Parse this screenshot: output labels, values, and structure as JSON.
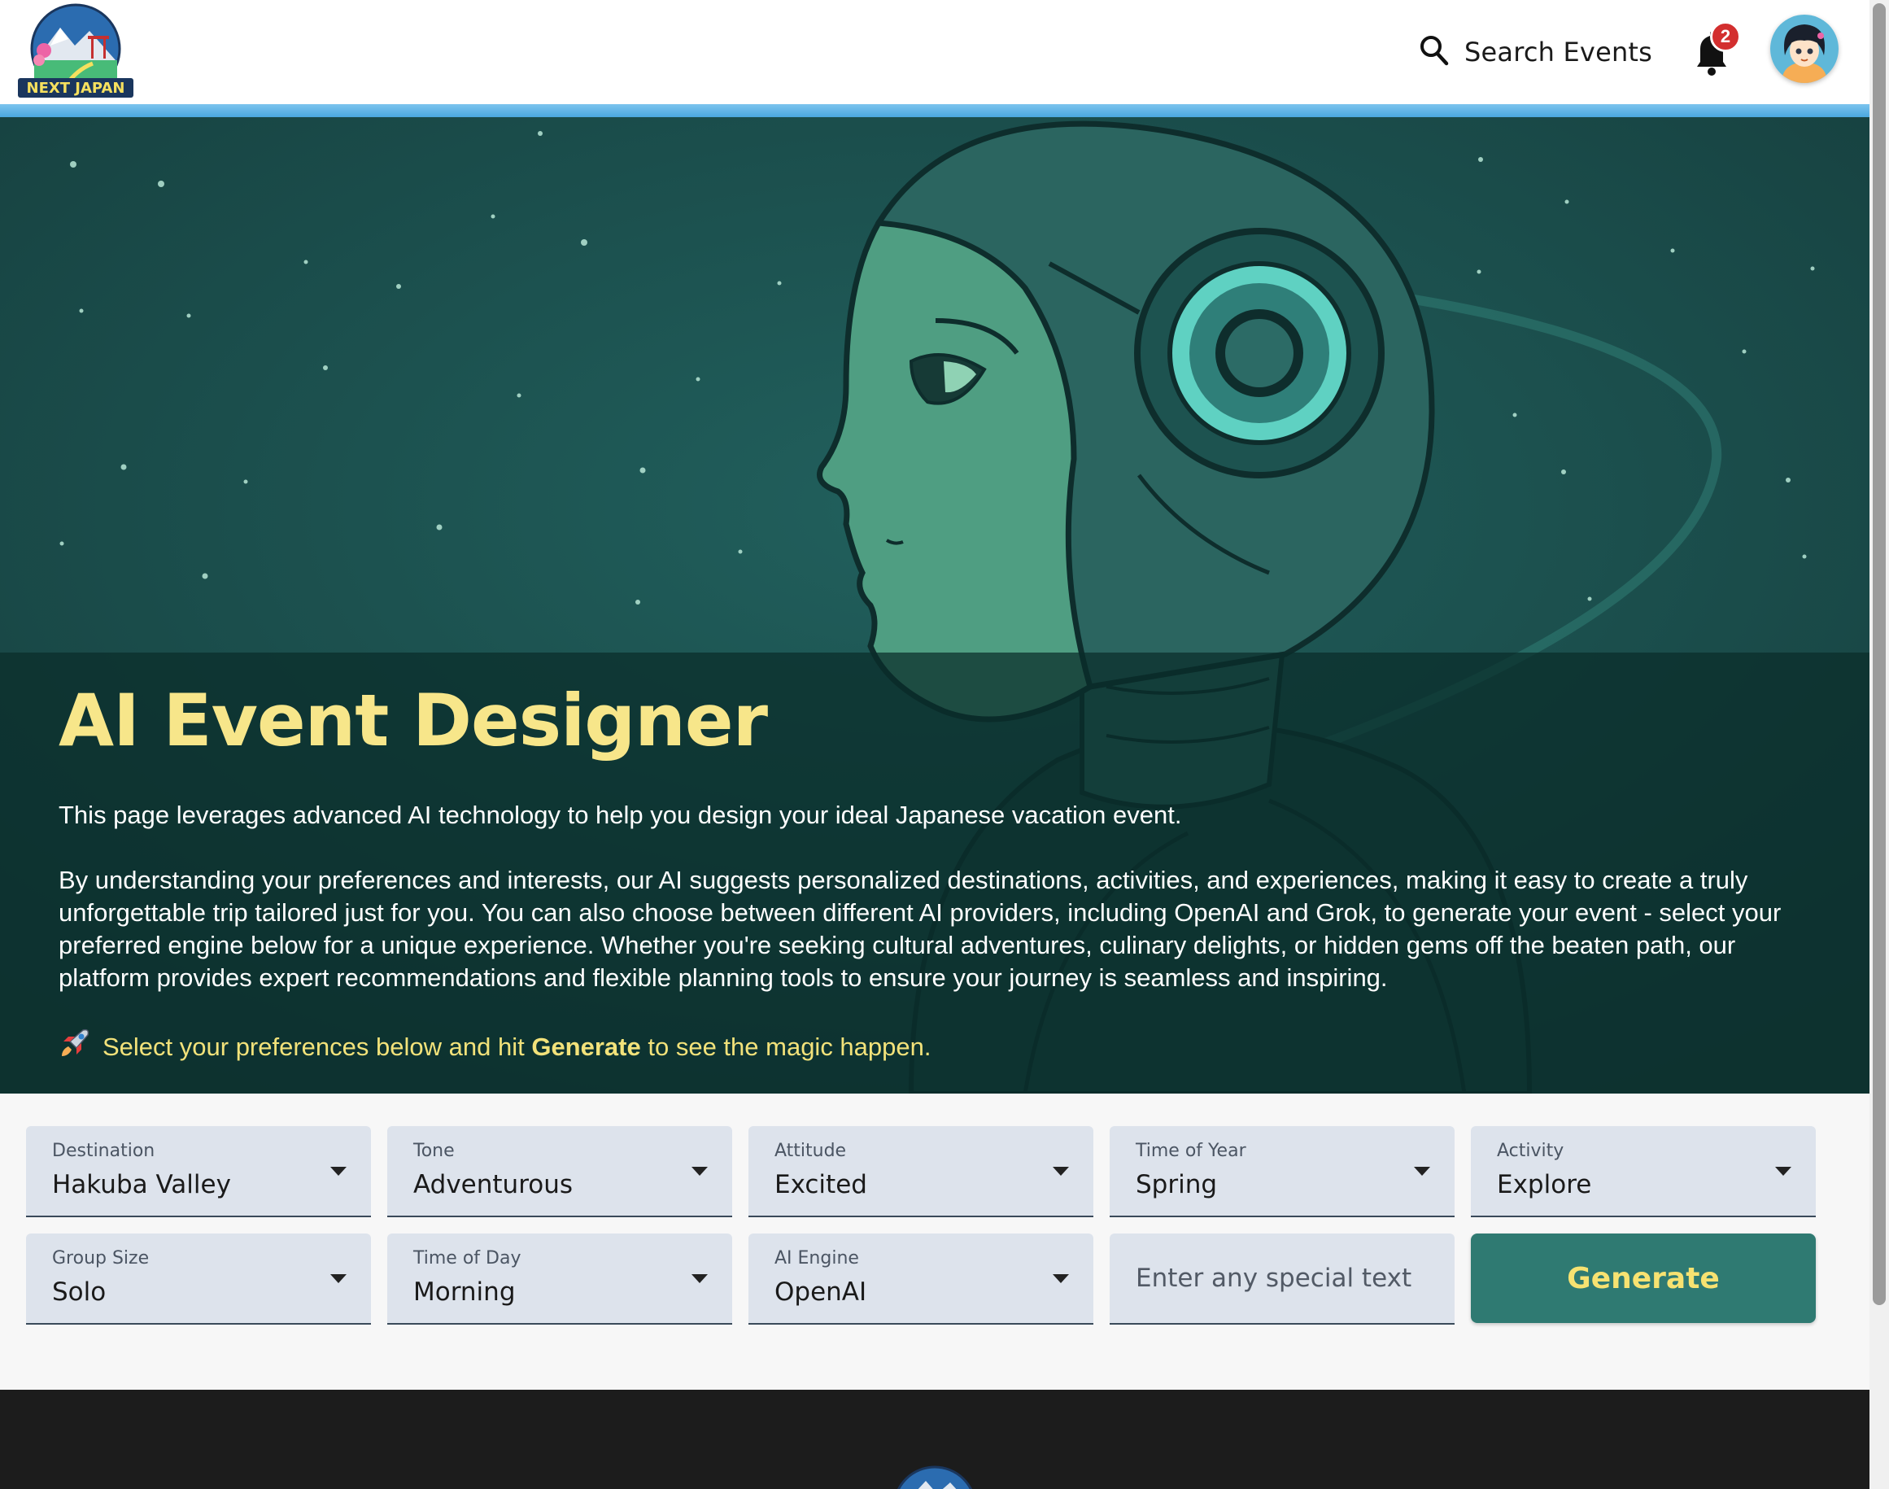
{
  "header": {
    "logo_text": "NEXT JAPAN",
    "search_label": "Search Events",
    "notification_count": "2"
  },
  "hero": {
    "title": "AI Event Designer",
    "paragraph1": "This page leverages advanced AI technology to help you design your ideal Japanese vacation event.",
    "paragraph2": "By understanding your preferences and interests, our AI suggests personalized destinations, activities, and experiences, making it easy to create a truly unforgettable trip tailored just for you. You can also choose between different AI providers, including OpenAI and Grok, to generate your event - select your preferred engine below for a unique experience. Whether you're seeking cultural adventures, culinary delights, or hidden gems off the beaten path, our platform provides expert recommendations and flexible planning tools to ensure your journey is seamless and inspiring.",
    "cta_icon": "rocket-icon",
    "cta_before": "Select your preferences below and hit",
    "cta_bold": "Generate",
    "cta_after": "to see the magic happen."
  },
  "form": {
    "destination": {
      "label": "Destination",
      "value": "Hakuba Valley"
    },
    "tone": {
      "label": "Tone",
      "value": "Adventurous"
    },
    "attitude": {
      "label": "Attitude",
      "value": "Excited"
    },
    "time_of_year": {
      "label": "Time of Year",
      "value": "Spring"
    },
    "activity": {
      "label": "Activity",
      "value": "Explore"
    },
    "group_size": {
      "label": "Group Size",
      "value": "Solo"
    },
    "time_of_day": {
      "label": "Time of Day",
      "value": "Morning"
    },
    "ai_engine": {
      "label": "AI Engine",
      "value": "OpenAI"
    },
    "special_text": {
      "placeholder": "Enter any special text",
      "value": ""
    },
    "generate_label": "Generate"
  },
  "colors": {
    "accent_teal": "#2f7a72",
    "title_yellow": "#f7e68a",
    "hero_bg": "#1d4e4d",
    "badge_red": "#d32f2f",
    "header_stripe": "#4aa7df"
  }
}
